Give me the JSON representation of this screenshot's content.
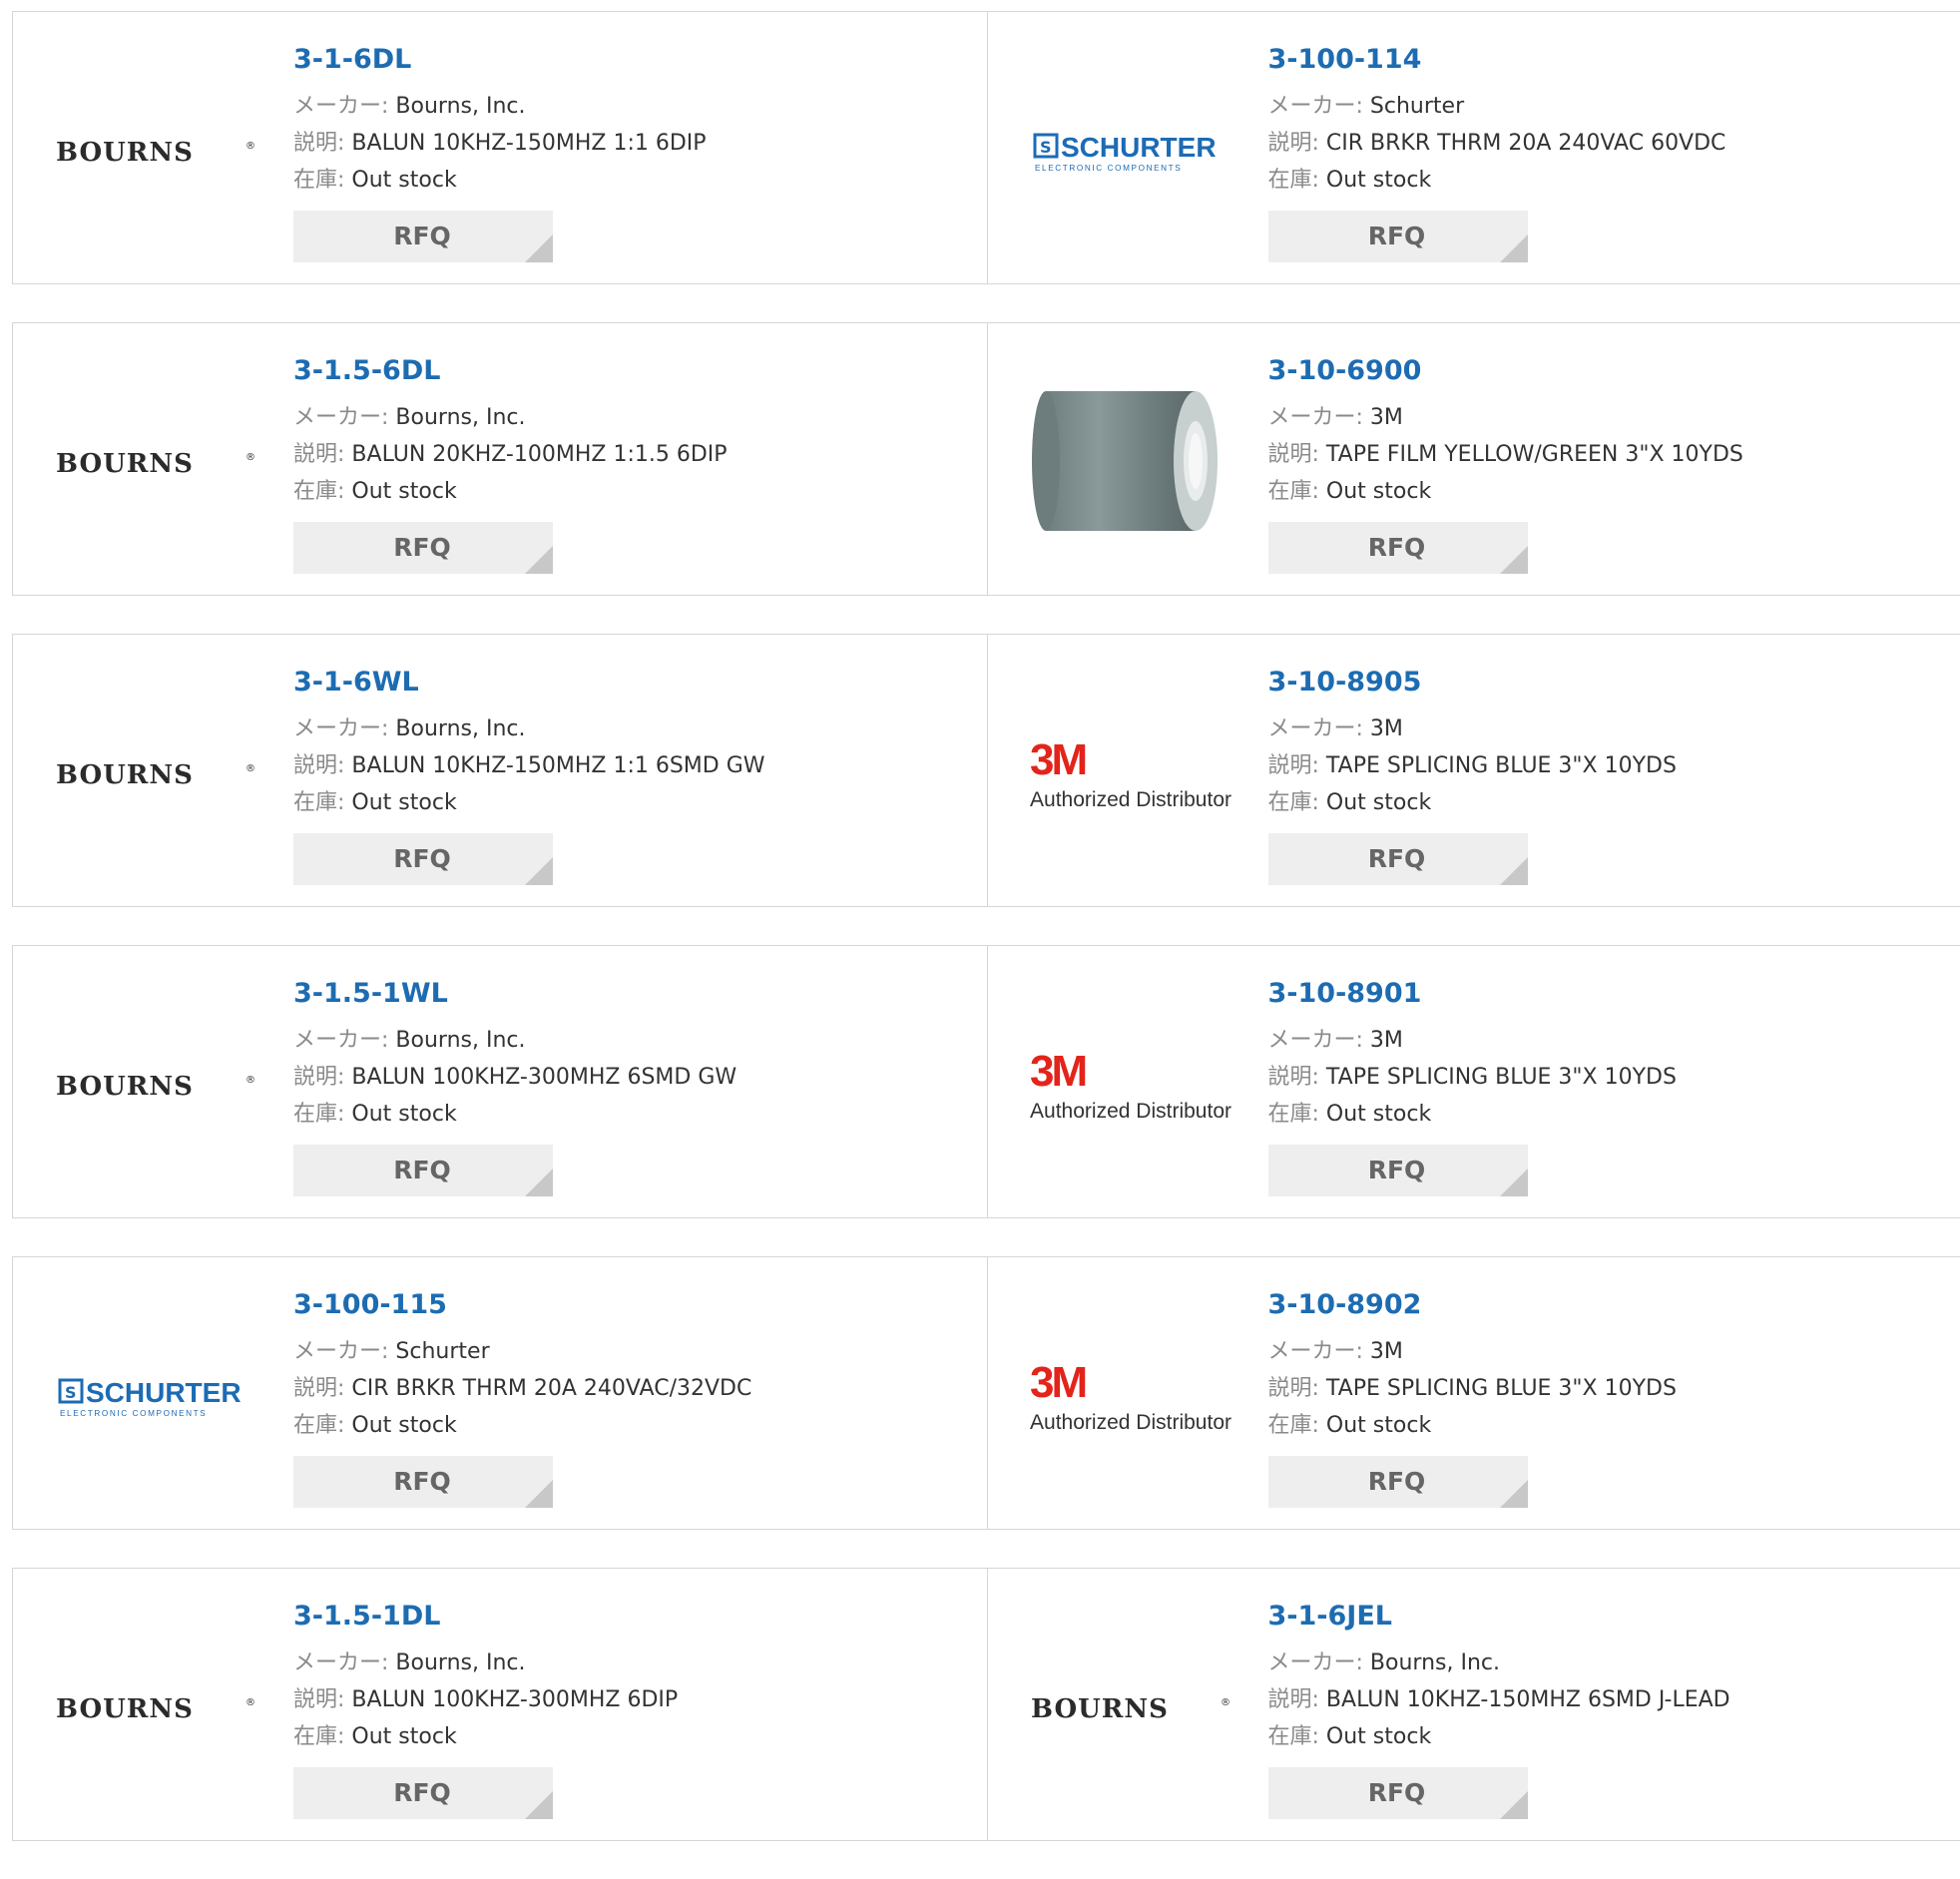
{
  "labels": {
    "maker": "メーカー:",
    "desc": "説明:",
    "stock": "在庫:",
    "rfq": "RFQ"
  },
  "logos": {
    "bourns": "BOURNS",
    "schurter_name": "SCHURTER",
    "schurter_sub": "ELECTRONIC COMPONENTS",
    "tm3_name": "3M",
    "tm3_sub": "Authorized Distributor"
  },
  "colors": {
    "link": "#1d6cb2",
    "schurter_blue": "#1c6bb5",
    "tm3_red": "#e3241b"
  },
  "rows": [
    [
      {
        "logo": "bourns",
        "part": "3-1-6DL",
        "maker": "Bourns, Inc.",
        "desc": "BALUN 10KHZ-150MHZ 1:1 6DIP",
        "stock": "Out stock"
      },
      {
        "logo": "schurter",
        "part": "3-100-114",
        "maker": "Schurter",
        "desc": "CIR BRKR THRM 20A 240VAC 60VDC",
        "stock": "Out stock"
      }
    ],
    [
      {
        "logo": "bourns",
        "part": "3-1.5-6DL",
        "maker": "Bourns, Inc.",
        "desc": "BALUN 20KHZ-100MHZ 1:1.5 6DIP",
        "stock": "Out stock"
      },
      {
        "logo": "tape",
        "part": "3-10-6900",
        "maker": "3M",
        "desc": "TAPE FILM YELLOW/GREEN 3\"X 10YDS",
        "stock": "Out stock"
      }
    ],
    [
      {
        "logo": "bourns",
        "part": "3-1-6WL",
        "maker": "Bourns, Inc.",
        "desc": "BALUN 10KHZ-150MHZ 1:1 6SMD GW",
        "stock": "Out stock"
      },
      {
        "logo": "3m",
        "part": "3-10-8905",
        "maker": "3M",
        "desc": "TAPE SPLICING BLUE 3\"X 10YDS",
        "stock": "Out stock"
      }
    ],
    [
      {
        "logo": "bourns",
        "part": "3-1.5-1WL",
        "maker": "Bourns, Inc.",
        "desc": "BALUN 100KHZ-300MHZ 6SMD GW",
        "stock": "Out stock"
      },
      {
        "logo": "3m",
        "part": "3-10-8901",
        "maker": "3M",
        "desc": "TAPE SPLICING BLUE 3\"X 10YDS",
        "stock": "Out stock"
      }
    ],
    [
      {
        "logo": "schurter",
        "part": "3-100-115",
        "maker": "Schurter",
        "desc": "CIR BRKR THRM 20A 240VAC/32VDC",
        "stock": "Out stock"
      },
      {
        "logo": "3m",
        "part": "3-10-8902",
        "maker": "3M",
        "desc": "TAPE SPLICING BLUE 3\"X 10YDS",
        "stock": "Out stock"
      }
    ],
    [
      {
        "logo": "bourns",
        "part": "3-1.5-1DL",
        "maker": "Bourns, Inc.",
        "desc": "BALUN 100KHZ-300MHZ 6DIP",
        "stock": "Out stock"
      },
      {
        "logo": "bourns",
        "part": "3-1-6JEL",
        "maker": "Bourns, Inc.",
        "desc": "BALUN 10KHZ-150MHZ 6SMD J-LEAD",
        "stock": "Out stock"
      }
    ]
  ]
}
